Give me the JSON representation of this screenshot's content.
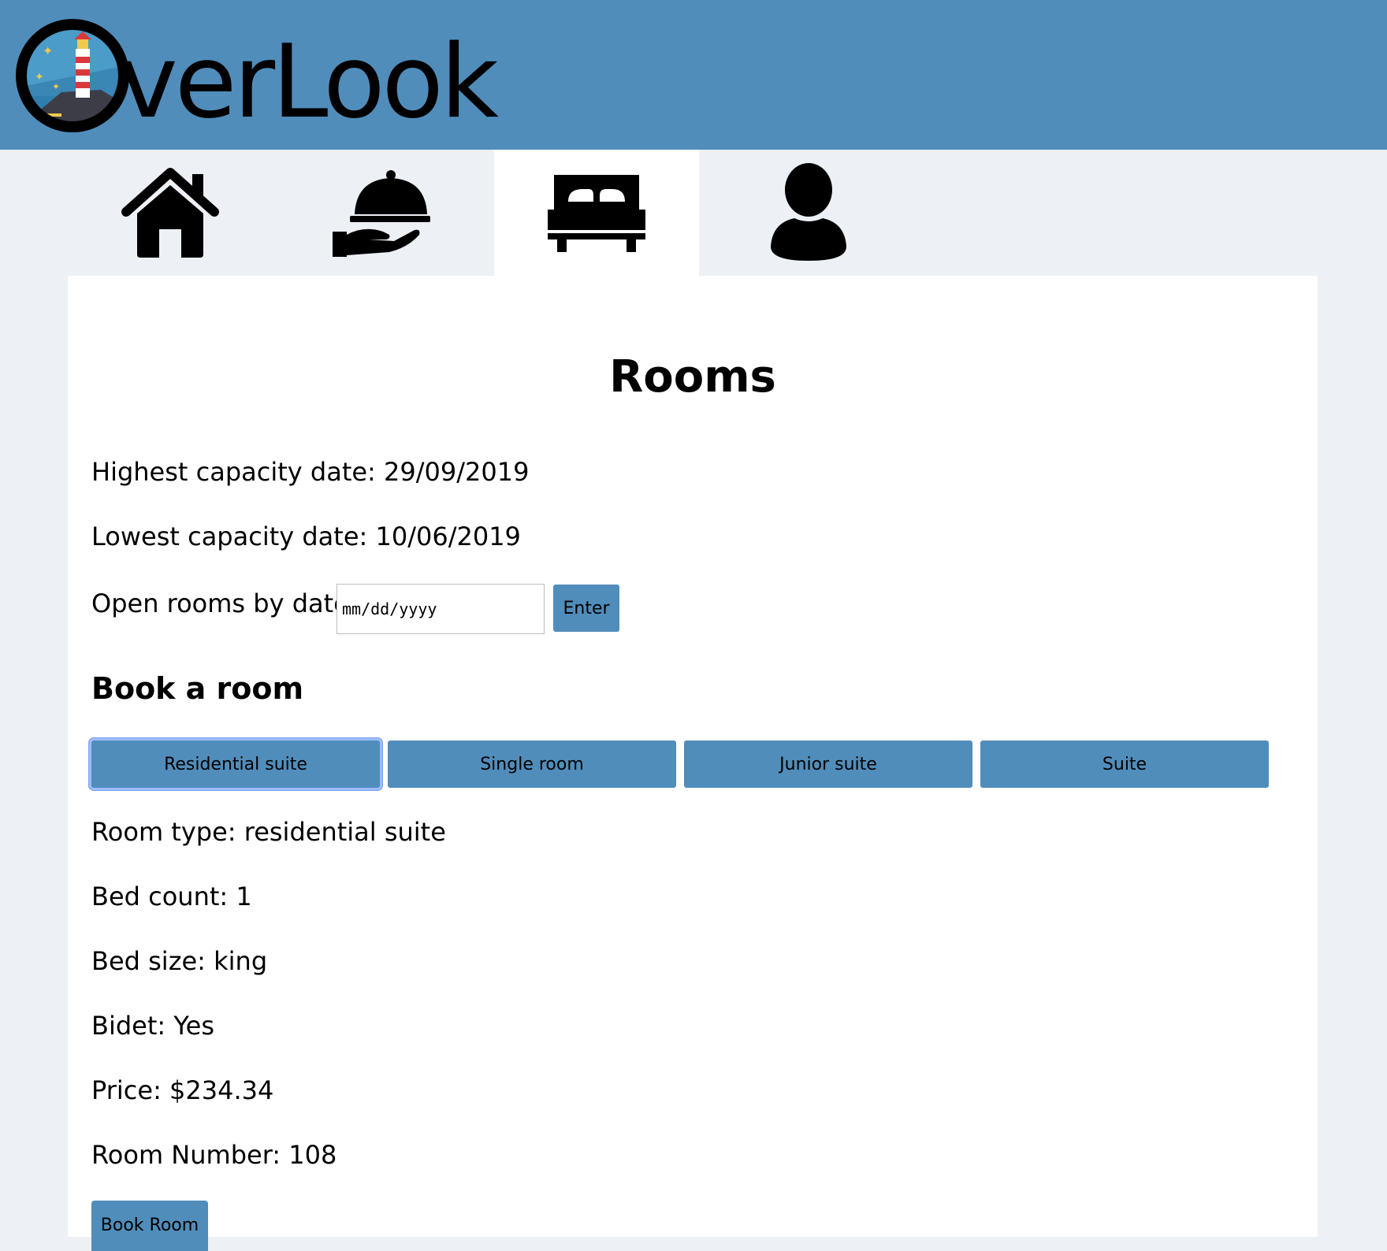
{
  "header": {
    "logo_text": "verLook",
    "logo_icon": "lighthouse-logo-icon",
    "brand_color": "#508dbb"
  },
  "nav": {
    "tabs": [
      {
        "icon": "home-icon",
        "active": false
      },
      {
        "icon": "room-service-icon",
        "active": false
      },
      {
        "icon": "bed-icon",
        "active": true
      },
      {
        "icon": "user-icon",
        "active": false
      }
    ]
  },
  "main": {
    "title": "Rooms",
    "highest_capacity": "Highest capacity date: 29/09/2019",
    "lowest_capacity": "Lowest capacity date: 10/06/2019",
    "open_rooms_label": "Open rooms by date:",
    "date_placeholder": "mm/dd/yyyy",
    "enter_label": "Enter",
    "book_title": "Book a room",
    "room_types": [
      "Residential suite",
      "Single room",
      "Junior suite",
      "Suite"
    ],
    "selected_room_type": "Residential suite",
    "details": {
      "room_type": "Room type: residential suite",
      "bed_count": "Bed count: 1",
      "bed_size": "Bed size: king",
      "bidet": "Bidet: Yes",
      "price": "Price: $234.34",
      "room_number": "Room Number: 108"
    },
    "book_button": "Book Room"
  }
}
